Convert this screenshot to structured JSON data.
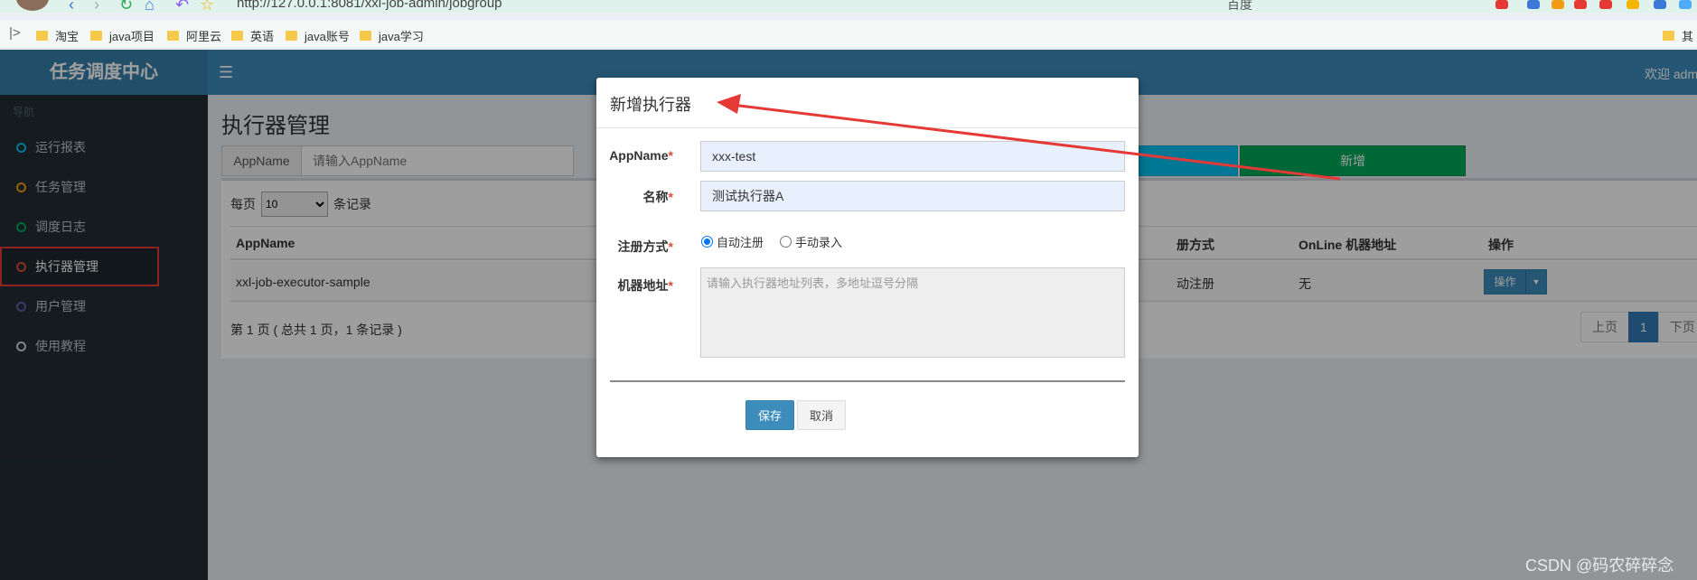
{
  "browser": {
    "url": "http://127.0.0.1:8081/xxl-job-admin/jobgroup",
    "search_engine": "百度",
    "bookmarks": [
      "淘宝",
      "java项目",
      "阿里云",
      "英语",
      "java账号",
      "java学习"
    ],
    "bookmarks_right": "其"
  },
  "app": {
    "logo": "任务调度中心",
    "welcome": "欢迎 adm"
  },
  "sidebar": {
    "header": "导航",
    "items": [
      {
        "label": "运行报表",
        "color": "#00c0ef"
      },
      {
        "label": "任务管理",
        "color": "#f39c12"
      },
      {
        "label": "调度日志",
        "color": "#00a65a"
      },
      {
        "label": "执行器管理",
        "color": "#dd4b39"
      },
      {
        "label": "用户管理",
        "color": "#605ca8"
      },
      {
        "label": "使用教程",
        "color": "#d2d6de"
      }
    ]
  },
  "main": {
    "title": "执行器管理",
    "filter_label": "AppName",
    "filter_placeholder": "请输入AppName",
    "add_button": "新增",
    "per_page_prefix": "每页",
    "per_page_value": "10",
    "per_page_suffix": "条记录",
    "columns": [
      "AppName",
      "册方式",
      "OnLine 机器地址",
      "操作"
    ],
    "rows": [
      {
        "appname": "xxl-job-executor-sample",
        "reg": "动注册",
        "online": "无",
        "op": "操作"
      }
    ],
    "info": "第 1 页 ( 总共 1 页，1 条记录 )",
    "pager": {
      "prev": "上页",
      "current": "1",
      "next": "下页"
    }
  },
  "modal": {
    "title": "新增执行器",
    "appname_label": "AppName",
    "appname_value": "xxx-test",
    "name_label": "名称",
    "name_value": "测试执行器A",
    "reg_label": "注册方式",
    "reg_auto": "自动注册",
    "reg_manual": "手动录入",
    "reg_selected": "auto",
    "addr_label": "机器地址",
    "addr_placeholder": "请输入执行器地址列表，多地址逗号分隔",
    "save": "保存",
    "cancel": "取消",
    "required_mark": "*"
  },
  "watermark": "CSDN @码农碎碎念",
  "colors": {
    "accent": "#3c8dbc",
    "annotation": "#e53935",
    "add": "#00a65a"
  }
}
